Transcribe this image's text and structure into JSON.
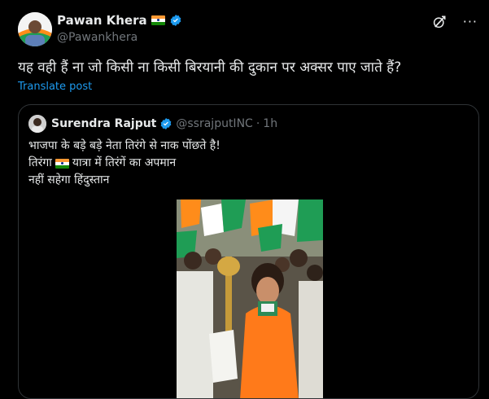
{
  "post": {
    "author_name": "Pawan Khera",
    "author_handle": "@Pawankhera",
    "text": "यह वही हैं ना जो किसी ना किसी बिरयानी की दुकान पर अक्सर पाए जाते हैं?",
    "translate_label": "Translate post"
  },
  "quoted": {
    "author_name": "Surendra Rajput",
    "author_handle": "@ssrajputINC",
    "separator": "·",
    "time": "1h",
    "line1": "भाजपा के बड़े बड़े नेता तिरंगे से नाक पोंछते है!",
    "line2_start": "तिरंगा",
    "line2_end": "यात्रा में तिरंगें का अपमान",
    "line3": "नहीं सहेगा हिंदुस्तान"
  },
  "icons": {
    "verified": "verified-badge-icon",
    "flag": "india-flag-icon",
    "grok": "grok-icon",
    "more": "more-options-icon"
  },
  "colors": {
    "accent": "#1d9bf0",
    "secondary_text": "#71767b",
    "border": "#2f3336"
  }
}
